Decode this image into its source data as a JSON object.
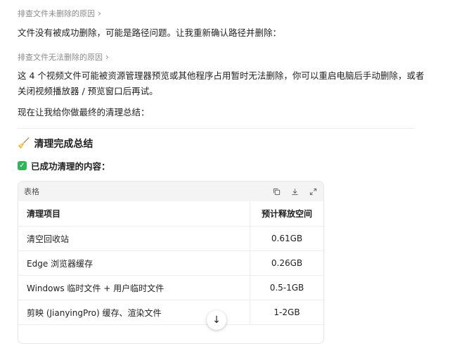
{
  "steps": [
    {
      "label": "排查文件未删除的原因"
    },
    {
      "label": "排查文件无法删除的原因"
    }
  ],
  "paragraphs": {
    "p1": "文件没有被成功删除，可能是路径问题。让我重新确认路径并删除：",
    "p2": "这 4 个视频文件可能被资源管理器预览或其他程序占用暂时无法删除，你可以重启电脑后手动删除，或者关闭视频播放器 / 预览窗口后再试。",
    "p3": "现在让我给你做最终的清理总结："
  },
  "summary": {
    "heading_icon": "broom-icon",
    "heading": "清理完成总结",
    "subheading": "已成功清理的内容："
  },
  "table": {
    "title": "表格",
    "tools": [
      "copy-icon",
      "download-icon",
      "expand-icon"
    ],
    "columns": [
      "清理项目",
      "预计释放空间"
    ],
    "rows": [
      [
        "清空回收站",
        "0.61GB"
      ],
      [
        "Edge 浏览器缓存",
        "0.26GB"
      ],
      [
        "Windows 临时文件 + 用户临时文件",
        "0.5-1GB"
      ],
      [
        "剪映 (JianyingPro) 缓存、渲染文件",
        "1-2GB"
      ]
    ]
  },
  "colors": {
    "check": "#2fb55a",
    "muted": "#8a8a8a"
  }
}
